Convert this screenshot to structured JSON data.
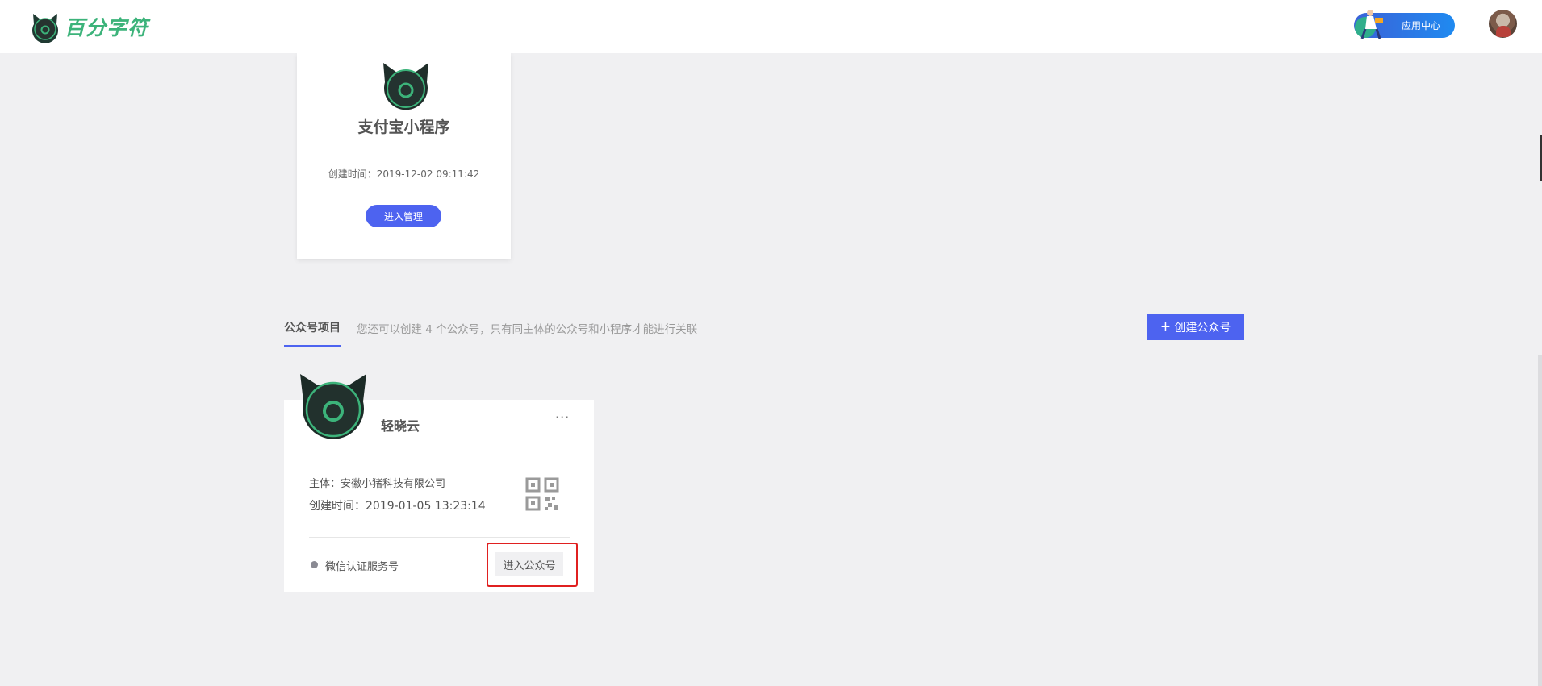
{
  "header": {
    "brand_name": "百分字符",
    "app_center_label": "应用中心"
  },
  "mini_program_card": {
    "title": "支付宝小程序",
    "created_time": "创建时间：2019-12-02 09:11:42",
    "manage_button": "进入管理"
  },
  "tabs": {
    "active_label": "公众号项目",
    "hint": "您还可以创建 4 个公众号，只有同主体的公众号和小程序才能进行关联",
    "create_button": "创建公众号"
  },
  "official_account": {
    "name": "轻晓云",
    "more": "···",
    "subject": "主体：安徽小猪科技有限公司",
    "created_time": "创建时间：2019-01-05 13:23:14",
    "type": "微信认证服务号",
    "enter_button": "进入公众号"
  },
  "colors": {
    "accent": "#4d63f0",
    "brand_green": "#3cb37a",
    "highlight_red": "#e02020",
    "page_bg": "#f0f0f2"
  },
  "icons": {
    "brand_logo": "cat-logo-icon",
    "qr": "qr-code-icon",
    "plus": "plus-icon",
    "more": "more-dots-icon"
  }
}
